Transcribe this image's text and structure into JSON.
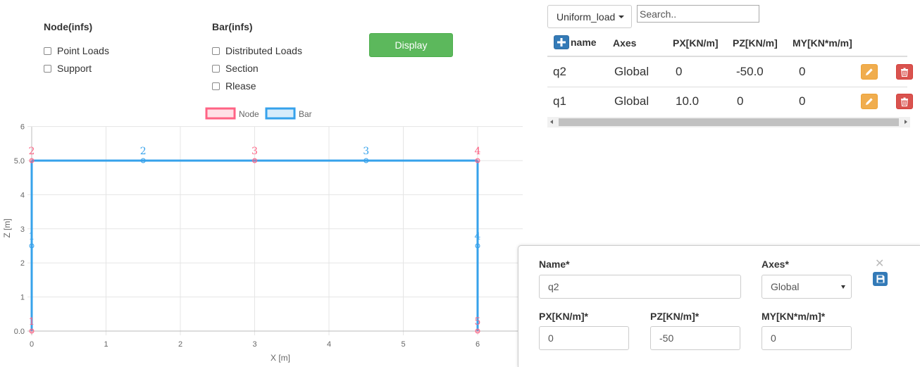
{
  "node_panel": {
    "title": "Node(infs)",
    "options": [
      {
        "label": "Point Loads",
        "checked": false
      },
      {
        "label": "Support",
        "checked": false
      }
    ]
  },
  "bar_panel": {
    "title": "Bar(infs)",
    "options": [
      {
        "label": "Distributed Loads",
        "checked": false
      },
      {
        "label": "Section",
        "checked": false
      },
      {
        "label": "Rlease",
        "checked": false
      }
    ]
  },
  "display_button": "Display",
  "load_table": {
    "dropdown_value": "Uniform_load",
    "search_placeholder": "Search..",
    "columns": [
      "name",
      "Axes",
      "PX[KN/m]",
      "PZ[KN/m]",
      "MY[KN*m/m]"
    ],
    "rows": [
      {
        "name": "q2",
        "axes": "Global",
        "px": "0",
        "pz": "-50.0",
        "my": "0"
      },
      {
        "name": "q1",
        "axes": "Global",
        "px": "10.0",
        "pz": "0",
        "my": "0"
      }
    ],
    "add_icon": "plus-icon",
    "edit_icon": "pencil-icon",
    "delete_icon": "trash-icon"
  },
  "edit_form": {
    "name_label": "Name*",
    "name_value": "q2",
    "axes_label": "Axes*",
    "axes_value": "Global",
    "px_label": "PX[KN/m]*",
    "px_value": "0",
    "pz_label": "PZ[KN/m]*",
    "pz_value": "-50",
    "my_label": "MY[KN*m/m]*",
    "my_value": "0",
    "close_icon": "close-icon",
    "save_icon": "save-icon"
  },
  "chart_data": {
    "type": "scatter",
    "legend": [
      "Node",
      "Bar"
    ],
    "legend_position": "top-center",
    "xlabel": "X [m]",
    "ylabel": "Z [m]",
    "xlim": [
      0,
      7
    ],
    "ylim": [
      0,
      6
    ],
    "xticks": [
      "0",
      "1",
      "2",
      "3",
      "4",
      "5",
      "6"
    ],
    "yticks": [
      "0.0",
      "1",
      "2",
      "3",
      "4",
      "5.0",
      "6"
    ],
    "grid": true,
    "colors": {
      "node": "#ff6384",
      "bar": "#36a2eb"
    },
    "nodes": [
      {
        "label": "1",
        "x": 0,
        "y": 0
      },
      {
        "label": "2",
        "x": 0,
        "y": 5
      },
      {
        "label": "3",
        "x": 3,
        "y": 5
      },
      {
        "label": "4",
        "x": 6,
        "y": 5
      },
      {
        "label": "5",
        "x": 6,
        "y": 0
      }
    ],
    "bars": [
      {
        "label": "1",
        "from": [
          0,
          0
        ],
        "to": [
          0,
          5
        ],
        "mid": [
          0,
          2.5
        ]
      },
      {
        "label": "2",
        "from": [
          0,
          5
        ],
        "to": [
          3,
          5
        ],
        "mid": [
          1.5,
          5
        ]
      },
      {
        "label": "3",
        "from": [
          3,
          5
        ],
        "to": [
          6,
          5
        ],
        "mid": [
          4.5,
          5
        ]
      },
      {
        "label": "4",
        "from": [
          6,
          5
        ],
        "to": [
          6,
          0
        ],
        "mid": [
          6,
          2.5
        ]
      }
    ]
  }
}
